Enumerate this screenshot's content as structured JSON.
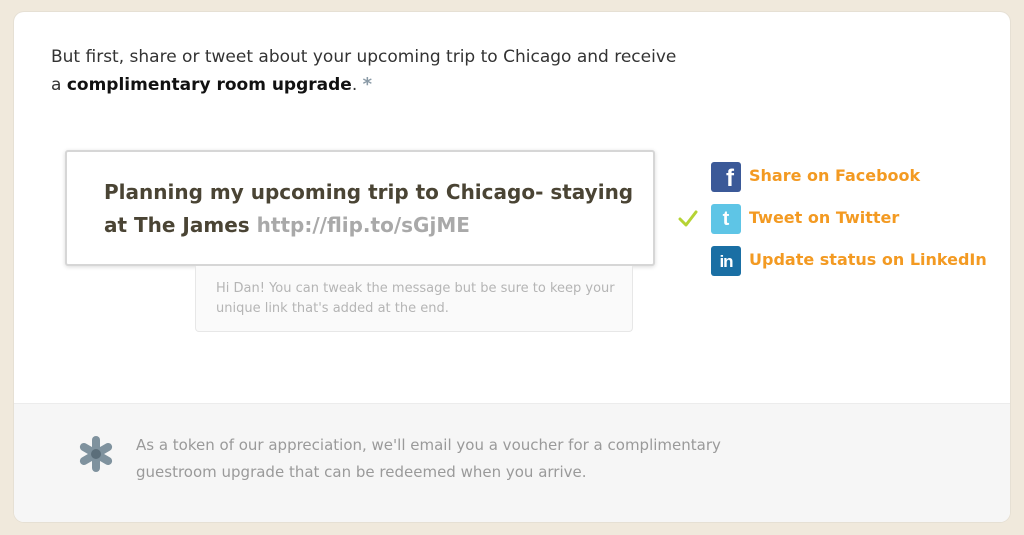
{
  "intro": {
    "text_before": "But first, share or tweet about your upcoming trip to Chicago and receive a ",
    "highlight": "complimentary room upgrade",
    "text_after": ".",
    "asterisk": "*"
  },
  "message": {
    "text": "Planning my upcoming trip to Chicago- staying at The James",
    "link": "http://flip.to/sGjME"
  },
  "hint": {
    "text": "Hi Dan! You can tweak the message but be sure to keep your unique link that's added at the end."
  },
  "share_options": [
    {
      "label": "Share on Facebook",
      "icon": "facebook-icon",
      "glyph": "f",
      "checked": false
    },
    {
      "label": "Tweet on Twitter",
      "icon": "twitter-icon",
      "glyph": "t",
      "checked": true
    },
    {
      "label": "Update status on LinkedIn",
      "icon": "linkedin-icon",
      "glyph": "in",
      "checked": false
    }
  ],
  "footer": {
    "text": "As a token of our appreciation, we'll email you a voucher for a complimentary guestroom upgrade that can be redeemed when you arrive."
  },
  "colors": {
    "accent": "#f39a22",
    "facebook": "#3b5998",
    "twitter": "#5ec5e6",
    "linkedin": "#1a6fa4",
    "check": "#b5d334",
    "background": "#f0e9dc"
  }
}
